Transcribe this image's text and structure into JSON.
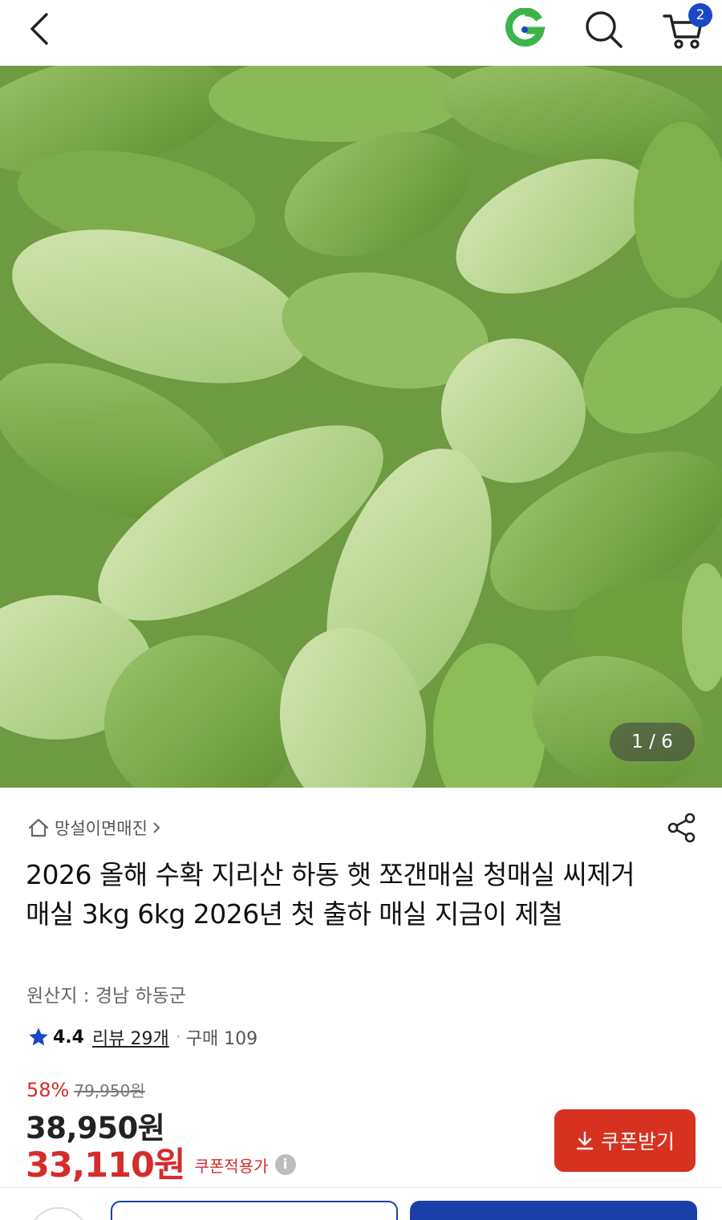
{
  "header": {
    "cart_count": "2"
  },
  "gallery": {
    "counter": "1 / 6"
  },
  "product": {
    "store_name": "망설이면매진",
    "title": "2026 올해 수확 지리산 하동 햇 쪼갠매실 청매실 씨제거 매실 3kg 6kg 2026년 첫 출하 매실 지금이 제철",
    "origin": "원산지 : 경남 하동군",
    "rating": "4.4",
    "review_label": "리뷰 29개",
    "dot": "·",
    "purchase_label": "구매 109"
  },
  "price": {
    "discount_rate": "58%",
    "original_price": "79,950원",
    "sale_price": "38,950원",
    "coupon_price": "33,110원",
    "coupon_label": "쿠폰적용가",
    "info_glyph": "i"
  },
  "coupon_button": {
    "label": "쿠폰받기"
  },
  "colors": {
    "accent_red": "#d62b2b",
    "brand_blue": "#1a49c5",
    "coupon_button": "#d7311f"
  }
}
